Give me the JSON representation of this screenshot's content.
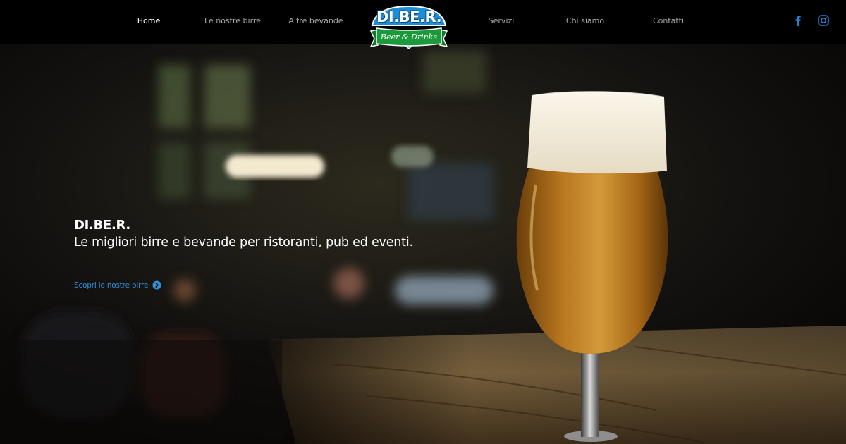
{
  "nav": {
    "items": [
      {
        "label": "Home",
        "active": true
      },
      {
        "label": "Le nostre birre",
        "active": false
      },
      {
        "label": "Altre bevande",
        "active": false
      },
      {
        "label": "Servizi",
        "active": false
      },
      {
        "label": "Chi siamo",
        "active": false
      },
      {
        "label": "Contatti",
        "active": false
      }
    ]
  },
  "logo": {
    "title": "DI.BE.R.",
    "subtitle": "Beer & Drinks",
    "colors": {
      "badge": "#1e8fd6",
      "ribbon": "#1a9a3a"
    }
  },
  "social": [
    {
      "icon": "facebook-icon"
    },
    {
      "icon": "instagram-icon"
    }
  ],
  "hero": {
    "title": "DI.BE.R.",
    "subtitle": "Le migliori birre e bevande per ristoranti, pub ed eventi.",
    "cta": {
      "label": "Scopri le nostre birre",
      "icon": "chevron-right-circle-icon"
    }
  },
  "colors": {
    "accent": "#2f8fd8",
    "navbar": "#000000",
    "nav_text": "#a8a8a8",
    "nav_active": "#ffffff"
  }
}
